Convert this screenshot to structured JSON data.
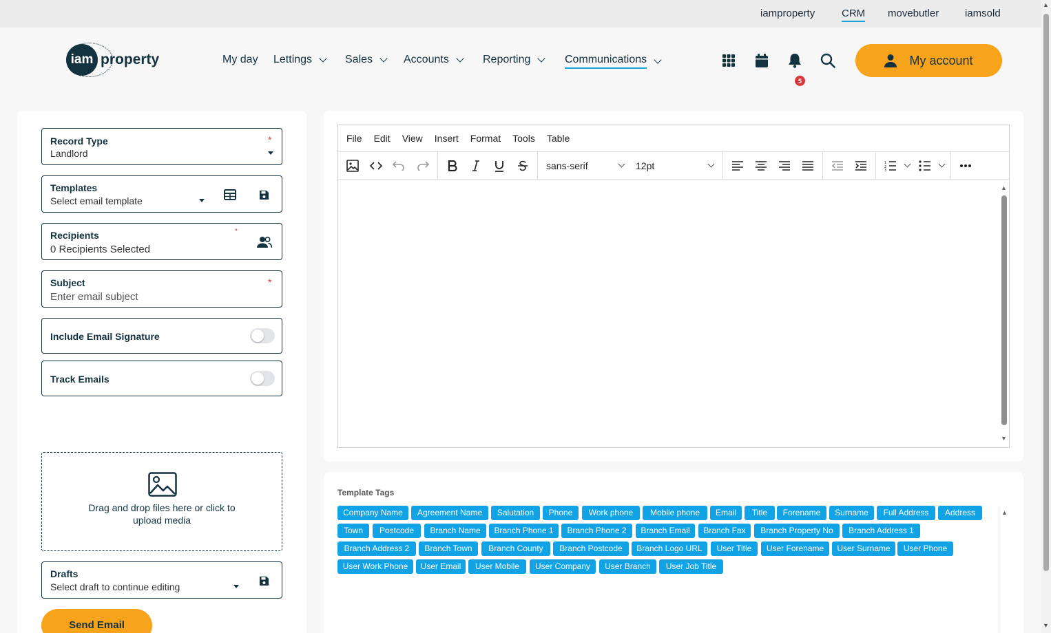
{
  "top_links": [
    "iamproperty",
    "CRM",
    "movebutler",
    "iamsold"
  ],
  "logo": {
    "mark": "iam",
    "word": "property"
  },
  "nav": {
    "my_day": "My day",
    "lettings": "Lettings",
    "sales": "Sales",
    "accounts": "Accounts",
    "reporting": "Reporting",
    "communications": "Communications"
  },
  "notifications_count": "5",
  "my_account": "My account",
  "form": {
    "record_type": {
      "label": "Record Type",
      "value": "Landlord"
    },
    "templates": {
      "label": "Templates",
      "placeholder": "Select email template"
    },
    "recipients": {
      "label": "Recipients",
      "value": "0 Recipients Selected"
    },
    "subject": {
      "label": "Subject",
      "placeholder": "Enter email subject"
    },
    "include_signature": "Include Email Signature",
    "track_emails": "Track Emails",
    "dropzone": "Drag and drop files here or click to upload media",
    "drafts": {
      "label": "Drafts",
      "placeholder": "Select draft to continue editing"
    },
    "send": "Send Email",
    "required_mark": "*"
  },
  "editor": {
    "menu": [
      "File",
      "Edit",
      "View",
      "Insert",
      "Format",
      "Tools",
      "Table"
    ],
    "font_family": "sans-serif",
    "font_size": "12pt"
  },
  "template_tags": {
    "title": "Template Tags",
    "rows": [
      [
        "Company Name",
        "Agreement Name",
        "Salutation",
        "Phone",
        "Work phone",
        "Mobile phone",
        "Email",
        "Title",
        "Forename",
        "Surname",
        "Full Address",
        "Address"
      ],
      [
        "Town",
        "Postcode",
        "Branch Name",
        "Branch Phone 1",
        "Branch Phone 2",
        "Branch Email",
        "Branch Fax",
        "Branch Property No",
        "Branch Address 1"
      ],
      [
        "Branch Address 2",
        "Branch Town",
        "Branch County",
        "Branch Postcode",
        "Branch Logo URL",
        "User Title",
        "User Forename",
        "User Surname",
        "User Phone"
      ],
      [
        "User Work Phone",
        "User Email",
        "User Mobile",
        "User Company",
        "User Branch",
        "User Job Title"
      ]
    ]
  },
  "colors": {
    "accent": "#f7a41c",
    "tag": "#12a3e6",
    "brand_dark": "#13323f"
  }
}
